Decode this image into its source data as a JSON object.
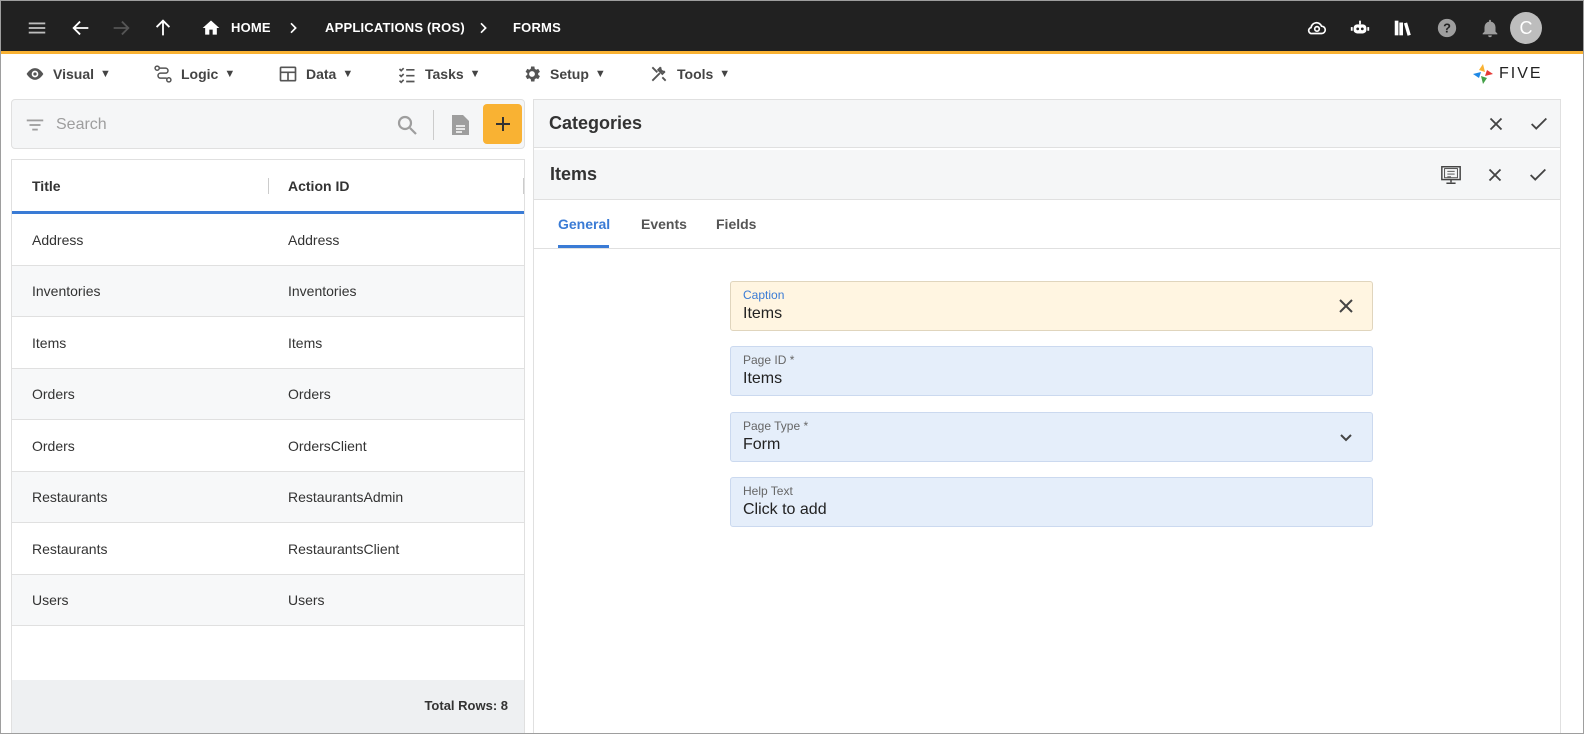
{
  "topbar": {
    "breadcrumbs": [
      {
        "label": "HOME"
      },
      {
        "label": "APPLICATIONS (ROS)"
      },
      {
        "label": "FORMS"
      }
    ],
    "avatar_initial": "C",
    "icons": [
      "menu-icon",
      "back-arrow-icon",
      "forward-arrow-icon",
      "up-arrow-icon",
      "home-icon",
      "cloud-icon",
      "robot-icon",
      "library-icon",
      "help-icon",
      "bell-icon"
    ]
  },
  "menubar": {
    "items": [
      {
        "label": "Visual",
        "icon": "eye-icon"
      },
      {
        "label": "Logic",
        "icon": "logic-icon"
      },
      {
        "label": "Data",
        "icon": "table-icon"
      },
      {
        "label": "Tasks",
        "icon": "tasks-icon"
      },
      {
        "label": "Setup",
        "icon": "gear-icon"
      },
      {
        "label": "Tools",
        "icon": "tools-icon"
      }
    ],
    "menu_arrow": "▼",
    "logo_text": "FIVE"
  },
  "search": {
    "placeholder": "Search"
  },
  "list": {
    "columns": [
      "Title",
      "Action ID"
    ],
    "rows": [
      {
        "title": "Address",
        "action_id": "Address"
      },
      {
        "title": "Inventories",
        "action_id": "Inventories"
      },
      {
        "title": "Items",
        "action_id": "Items"
      },
      {
        "title": "Orders",
        "action_id": "Orders"
      },
      {
        "title": "Orders",
        "action_id": "OrdersClient"
      },
      {
        "title": "Restaurants",
        "action_id": "RestaurantsAdmin"
      },
      {
        "title": "Restaurants",
        "action_id": "RestaurantsClient"
      },
      {
        "title": "Users",
        "action_id": "Users"
      }
    ],
    "total_rows": "Total Rows: 8"
  },
  "detail": {
    "parent_title": "Categories",
    "title": "Items",
    "tabs": [
      {
        "label": "General",
        "active": true
      },
      {
        "label": "Events",
        "active": false
      },
      {
        "label": "Fields",
        "active": false
      }
    ],
    "fields": [
      {
        "label": "Caption",
        "value": "Items"
      },
      {
        "label": "Page ID *",
        "value": "Items"
      },
      {
        "label": "Page Type *",
        "value": "Form"
      },
      {
        "label": "Help Text",
        "value": "Click to add"
      }
    ]
  },
  "colors": {
    "topbar": "#212121",
    "accent": "#f9b233",
    "primary": "#3a7bd5",
    "field_bg": "#e5eefa",
    "field_focus_bg": "#fff5e1"
  }
}
